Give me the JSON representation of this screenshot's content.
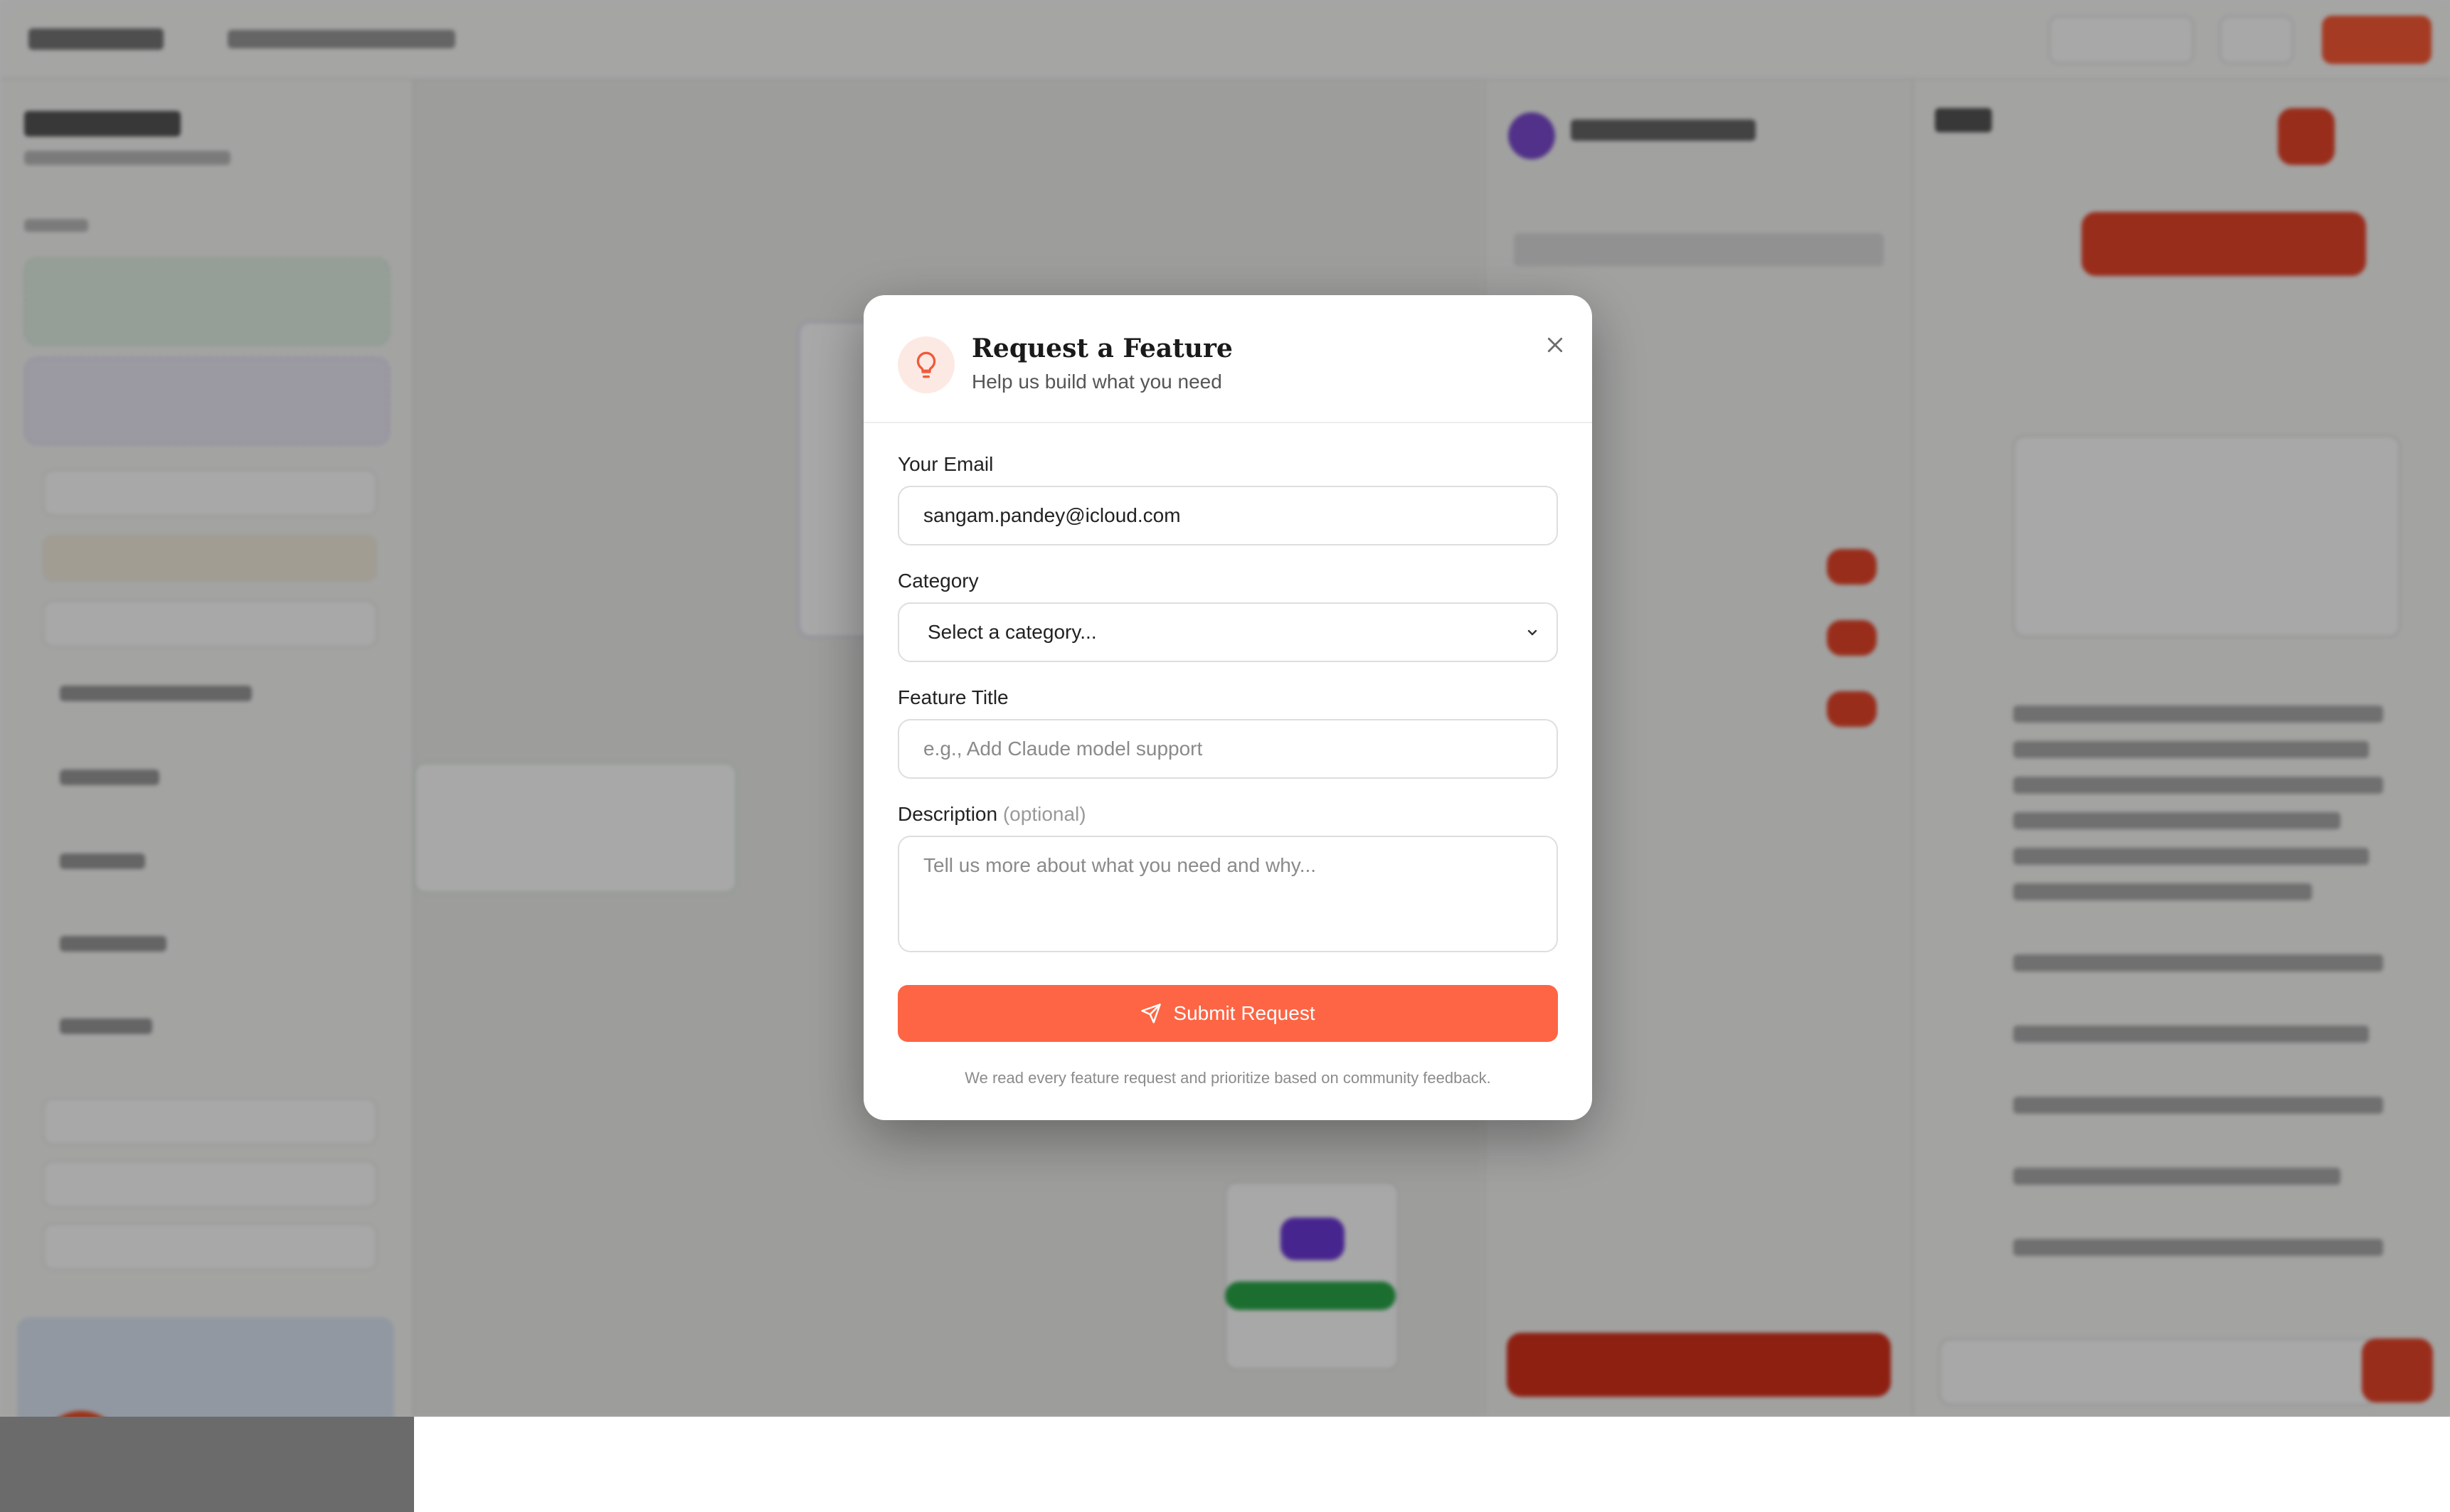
{
  "modal": {
    "title": "Request a Feature",
    "subtitle": "Help us build what you need",
    "email_label": "Your Email",
    "email_value": "sangam.pandey@icloud.com",
    "category_label": "Category",
    "category_selected": "Select a category...",
    "feature_title_label": "Feature Title",
    "feature_title_placeholder": "e.g., Add Claude model support",
    "description_label": "Description",
    "description_optional": "(optional)",
    "description_placeholder": "Tell us more about what you need and why...",
    "submit_label": "Submit Request",
    "footer_note": "We read every feature request and prioritize based on community feedback."
  },
  "colors": {
    "accent": "#fd6544",
    "icon_bg": "#fde9e3",
    "overlay": "rgba(0,0,0,0.34)"
  },
  "icons": {
    "header": "lightbulb-icon",
    "close": "close-icon",
    "select": "chevron-down-icon",
    "submit": "send-icon"
  }
}
